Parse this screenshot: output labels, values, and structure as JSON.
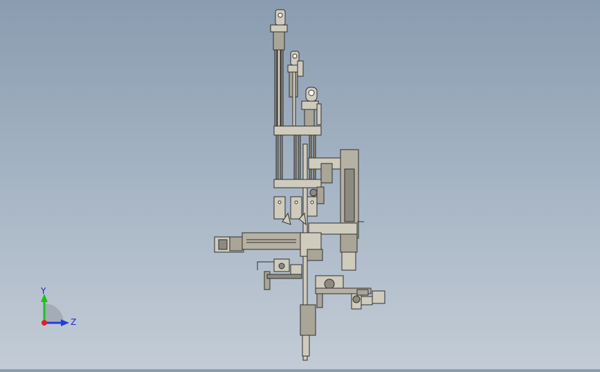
{
  "viewport": {
    "background_top": "#8a9cb0",
    "background_bottom": "#c3ccd6"
  },
  "model": {
    "line_color": "#2e2e2e",
    "fill_color": "#a9a597",
    "highlight_color": "#cfcbbd"
  },
  "triad": {
    "y_label": "Y",
    "z_label": "Z",
    "y_color": "#1fbf1f",
    "z_color": "#1f3fdf",
    "x_color": "#e02020"
  }
}
